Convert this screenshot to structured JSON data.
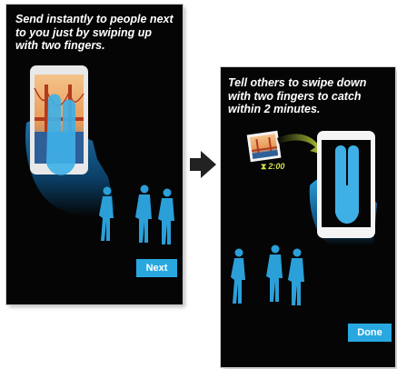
{
  "steps": [
    {
      "instruction": "Send instantly to people next to you just by swiping up with two fingers.",
      "button_label": "Next"
    },
    {
      "instruction": "Tell others to swipe down with two fingers to catch within 2 minutes.",
      "timer_text": "2:00",
      "button_label": "Done"
    }
  ],
  "icons": {
    "step_arrow": "right-arrow-icon",
    "timer": "hourglass-icon",
    "photo": "golden-gate-photo-icon"
  },
  "colors": {
    "screen_background": "#050505",
    "accent_blue": "#29a8e0",
    "timer_green": "#d4e04a",
    "arrow_dark": "#222222"
  }
}
